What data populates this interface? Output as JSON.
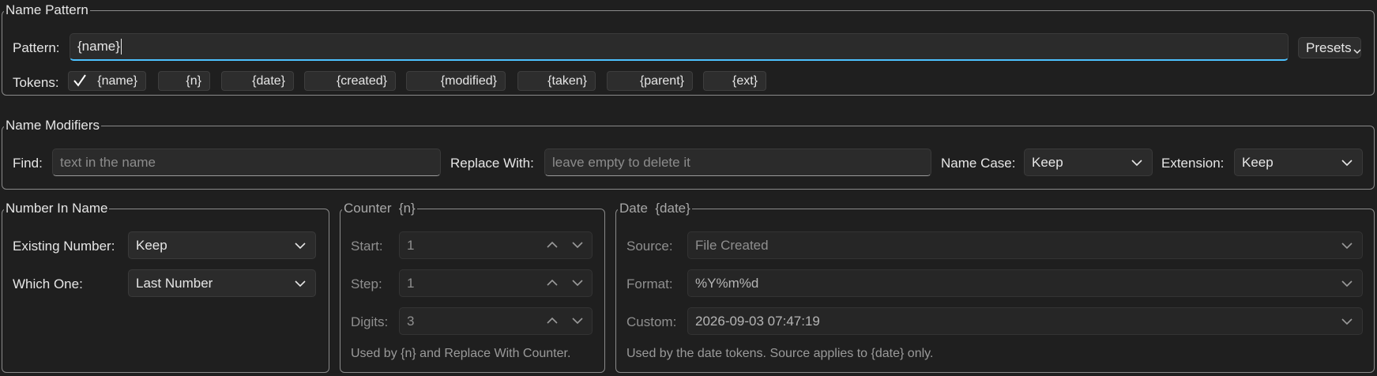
{
  "name_pattern": {
    "title": "Name Pattern",
    "pattern_label": "Pattern:",
    "pattern_value": "{name}",
    "presets_label": "Presets",
    "tokens_label": "Tokens:",
    "tokens": [
      {
        "label": "{name}",
        "checked": true
      },
      {
        "label": "{n}",
        "checked": false
      },
      {
        "label": "{date}",
        "checked": false
      },
      {
        "label": "{created}",
        "checked": false
      },
      {
        "label": "{modified}",
        "checked": false
      },
      {
        "label": "{taken}",
        "checked": false
      },
      {
        "label": "{parent}",
        "checked": false
      },
      {
        "label": "{ext}",
        "checked": false
      }
    ]
  },
  "name_modifiers": {
    "title": "Name Modifiers",
    "find_label": "Find:",
    "find_placeholder": "text in the name",
    "replace_label": "Replace With:",
    "replace_placeholder": "leave empty to delete it",
    "case_label": "Name Case:",
    "case_value": "Keep",
    "extension_label": "Extension:",
    "extension_value": "Keep"
  },
  "number_in_name": {
    "title": "Number In Name",
    "existing_label": "Existing Number:",
    "existing_value": "Keep",
    "which_label": "Which One:",
    "which_value": "Last Number"
  },
  "counter": {
    "title": "Counter  {n}",
    "start_label": "Start:",
    "start_value": "1",
    "step_label": "Step:",
    "step_value": "1",
    "digits_label": "Digits:",
    "digits_value": "3",
    "note": "Used by {n} and Replace With Counter."
  },
  "date": {
    "title": "Date  {date}",
    "source_label": "Source:",
    "source_value": "File Created",
    "format_label": "Format:",
    "format_value": "%Y%m%d",
    "custom_label": "Custom:",
    "custom_value": "2026-09-03 07:47:19",
    "note": "Used by the date tokens. Source applies to {date} only."
  },
  "colors": {
    "accent": "#4cc2ff",
    "background": "#1f1f1f",
    "border": "#8a8a8a"
  }
}
